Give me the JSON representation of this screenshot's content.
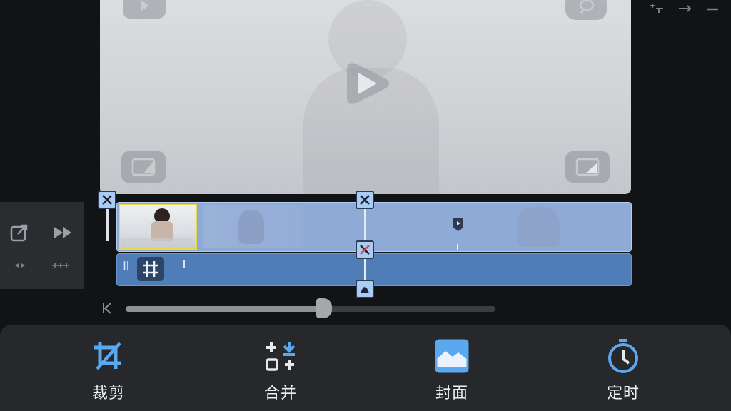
{
  "toolbar": {
    "items": [
      {
        "label": "裁剪",
        "icon": "crop-icon"
      },
      {
        "label": "合并",
        "icon": "merge-icon"
      },
      {
        "label": "封面",
        "icon": "cover-image-icon"
      },
      {
        "label": "定时",
        "icon": "timer-icon"
      }
    ]
  },
  "playback": {
    "progress": 0.53
  },
  "colors": {
    "accent": "#5aa8f0",
    "track_main": "#8eaad6",
    "track_sub": "#4f7db8",
    "toolbar_bg": "#26282c",
    "background": "#121315"
  },
  "icons": {
    "window": [
      "split-window-icon",
      "arrow-right-icon",
      "minimize-icon"
    ],
    "preview": [
      "play-icon",
      "picture-in-picture-icon",
      "comment-icon",
      "play-overlay-icon"
    ],
    "left_panel": [
      "export-icon",
      "fast-forward-icon",
      "trim-left-icon",
      "expand-icon"
    ],
    "timeline": [
      "close-icon",
      "crop-grid-icon",
      "marker-icon"
    ],
    "slider": [
      "skip-start-icon"
    ]
  }
}
